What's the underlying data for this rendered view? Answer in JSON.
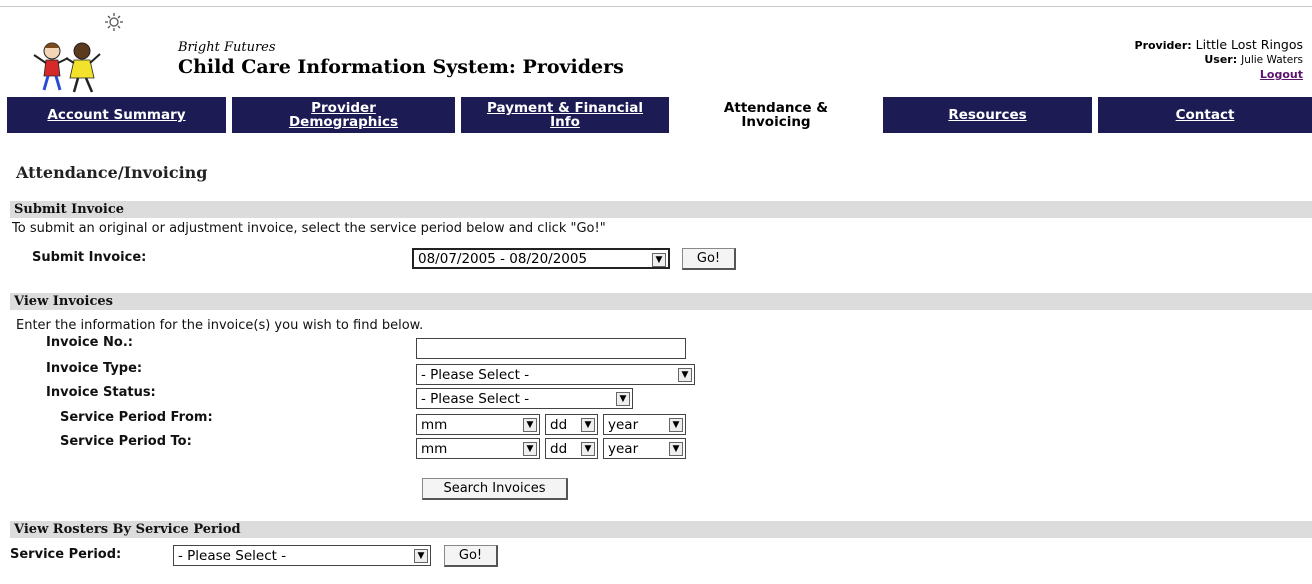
{
  "header": {
    "brand_subtitle": "Bright Futures",
    "brand_title": "Child Care Information System: Providers",
    "provider_label": "Provider:",
    "provider_name": "Little Lost Ringos",
    "user_label": "User:",
    "user_name": "Julie Waters",
    "logout_label": "Logout"
  },
  "nav": {
    "tabs": [
      {
        "line1": "Account Summary",
        "line2": ""
      },
      {
        "line1": "Provider",
        "line2": "Demographics"
      },
      {
        "line1": "Payment & Financial",
        "line2": "Info"
      },
      {
        "line1": "Attendance &",
        "line2": "Invoicing"
      },
      {
        "line1": "Resources",
        "line2": ""
      },
      {
        "line1": "Contact",
        "line2": ""
      }
    ],
    "active_index": 3
  },
  "page_title": "Attendance/Invoicing",
  "submit_invoice": {
    "section_title": "Submit Invoice",
    "instructions": "To submit an original or adjustment invoice, select the service period below and click \"Go!\"",
    "label": "Submit Invoice:",
    "selected_period": "08/07/2005 - 08/20/2005",
    "go_label": "Go!"
  },
  "view_invoices": {
    "section_title": "View Invoices",
    "instructions": "Enter the information for the invoice(s) you wish to find below.",
    "invoice_no_label": "Invoice No.:",
    "invoice_no_value": "",
    "invoice_type_label": "Invoice Type:",
    "invoice_type_value": "- Please Select -",
    "invoice_status_label": "Invoice Status:",
    "invoice_status_value": "- Please Select -",
    "period_from_label": "Service Period From:",
    "period_to_label": "Service Period To:",
    "mm": "mm",
    "dd": "dd",
    "year": "year",
    "search_label": "Search Invoices"
  },
  "rosters": {
    "section_title": "View Rosters By Service Period",
    "label": "Service Period:",
    "value": "- Please Select -",
    "go_label": "Go!"
  },
  "icons": {
    "dropdown": "chevron-down-icon",
    "logo": "kids-logo-icon"
  },
  "colors": {
    "nav_bg": "#1d1b54",
    "section_bg": "#dcdcdc",
    "logout_link": "#5b1470"
  }
}
